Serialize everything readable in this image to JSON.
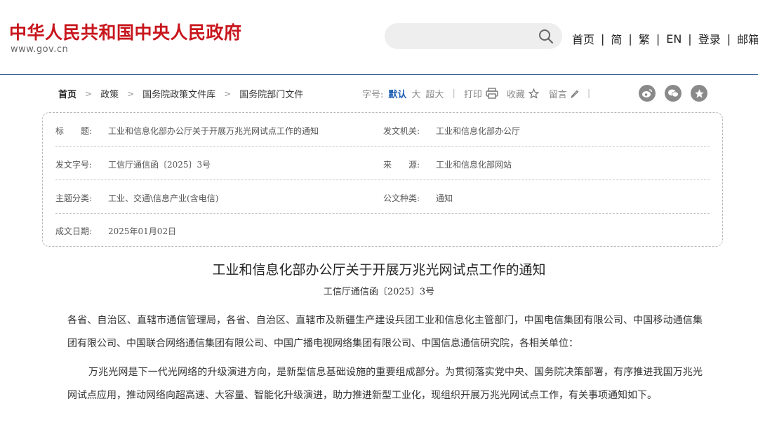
{
  "header": {
    "site_title": "中华人民共和国中央人民政府",
    "site_url": "www.gov.cn",
    "search_placeholder": "",
    "nav": [
      "首页",
      "简",
      "繁",
      "EN",
      "登录",
      "邮箱"
    ],
    "nav_separator": "|"
  },
  "breadcrumb": {
    "items": [
      "首页",
      "政策",
      "国务院政策文件库",
      "国务院部门文件"
    ],
    "arrow": ">"
  },
  "tools": {
    "font_label": "字号:",
    "font_sizes": [
      "默认",
      "大",
      "超大"
    ],
    "active_font": "默认",
    "print": "打印",
    "favorite": "收藏",
    "comment": "留言",
    "separator": "|",
    "share_icons": [
      "weibo-icon",
      "wechat-icon",
      "qzone-icon"
    ]
  },
  "meta": {
    "title_label": "标　　题:",
    "title_value": "工业和信息化部办公厅关于开展万兆光网试点工作的通知",
    "issuer_label": "发文机关:",
    "issuer_value": "工业和信息化部办公厅",
    "doc_no_label": "发文字号:",
    "doc_no_value": "工信厅通信函〔2025〕3号",
    "source_label": "来　　源:",
    "source_value": "工业和信息化部网站",
    "topic_label": "主题分类:",
    "topic_value": "工业、交通\\信息产业(含电信)",
    "type_label": "公文种类:",
    "type_value": "通知",
    "date_label": "成文日期:",
    "date_value": "2025年01月02日"
  },
  "document": {
    "title": "工业和信息化部办公厅关于开展万兆光网试点工作的通知",
    "number": "工信厅通信函〔2025〕3号",
    "paragraphs": [
      "各省、自治区、直辖市通信管理局，各省、自治区、直辖市及新疆生产建设兵团工业和信息化主管部门，中国电信集团有限公司、中国移动通信集团有限公司、中国联合网络通信集团有限公司、中国广播电视网络集团有限公司、中国信息通信研究院，各相关单位：",
      "万兆光网是下一代光网络的升级演进方向，是新型信息基础设施的重要组成部分。为贯彻落实党中央、国务院决策部署，有序推进我国万兆光网试点应用，推动网络向超高速、大容量、智能化升级演进，助力推进新型工业化，现组织开展万兆光网试点工作，有关事项通知如下。"
    ]
  },
  "colors": {
    "brand_red": "#c8161d",
    "link_blue": "#1e5fb4",
    "header_rule": "#1f4a8a"
  }
}
